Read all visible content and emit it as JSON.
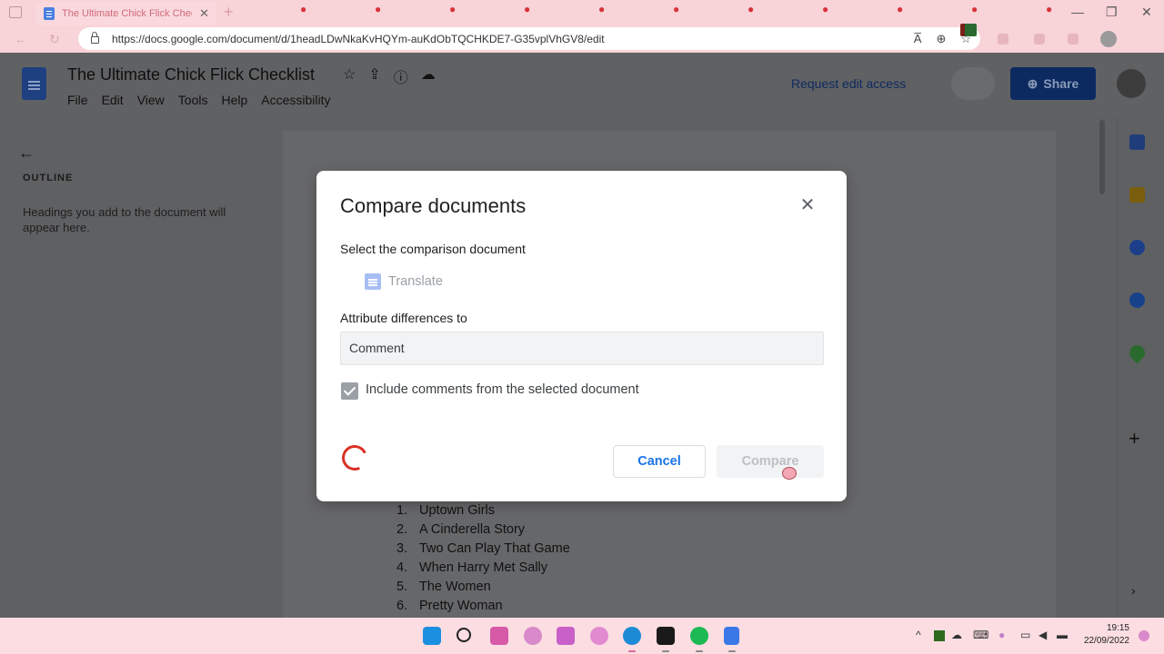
{
  "browser": {
    "tab_title": "The Ultimate Chick Flick Checklist",
    "tab_close": "✕",
    "new_tab": "+",
    "url": "https://docs.google.com/document/d/1headLDwNkaKvHQYm-auKdObTQCHKDE7-G35vplVhGV8/edit",
    "window_minimize": "—",
    "window_restore": "❐",
    "window_close": "✕",
    "reader_icon_text": "A̅",
    "zoom_icon_text": "⊕",
    "favorite_icon_text": "☆"
  },
  "docs": {
    "title": "The Ultimate Chick Flick Checklist",
    "menu": [
      "File",
      "Edit",
      "View",
      "Tools",
      "Help",
      "Accessibility"
    ],
    "request_access": "Request edit access",
    "share_label": "Share",
    "star_icon": "☆",
    "move_icon": "⇪",
    "info_icon": "ⓘ",
    "cloud_icon": "☁"
  },
  "outline": {
    "back_icon": "←",
    "label": "OUTLINE",
    "hint": "Headings you add to the document will appear here."
  },
  "document": {
    "movies": [
      {
        "num": "1.",
        "title": "Uptown Girls"
      },
      {
        "num": "2.",
        "title": "A Cinderella Story"
      },
      {
        "num": "3.",
        "title": "Two Can Play That Game"
      },
      {
        "num": "4.",
        "title": "When Harry Met Sally"
      },
      {
        "num": "5.",
        "title": "The Women"
      },
      {
        "num": "6.",
        "title": "Pretty Woman"
      }
    ]
  },
  "side_panel": {
    "add_icon": "+",
    "expand_icon": "›",
    "colors": {
      "calendar": "#1f3d7a",
      "keep": "#7a5e0d",
      "tasks": "#1d3f8a",
      "contacts": "#17428a",
      "maps": "#2b6a2e"
    }
  },
  "dialog": {
    "title": "Compare documents",
    "close_icon": "✕",
    "select_label": "Select the comparison document",
    "selected_doc": "Translate",
    "attribute_label": "Attribute differences to",
    "attribute_value": "Comment",
    "include_comments_label": "Include comments from the selected document",
    "include_comments_checked": true,
    "cancel_label": "Cancel",
    "compare_label": "Compare"
  },
  "taskbar": {
    "time": "19:15",
    "date": "22/09/2022",
    "apps": [
      "windows-start",
      "search",
      "app-1",
      "discord",
      "illustrator",
      "app-2",
      "edge",
      "capcut",
      "spotify",
      "docs"
    ]
  },
  "colors": {
    "chrome_pink": "#f8d3d8",
    "accent_blue": "#1a73e8",
    "overlay_grey": "#5f6062",
    "spinner_red": "#d93025"
  }
}
